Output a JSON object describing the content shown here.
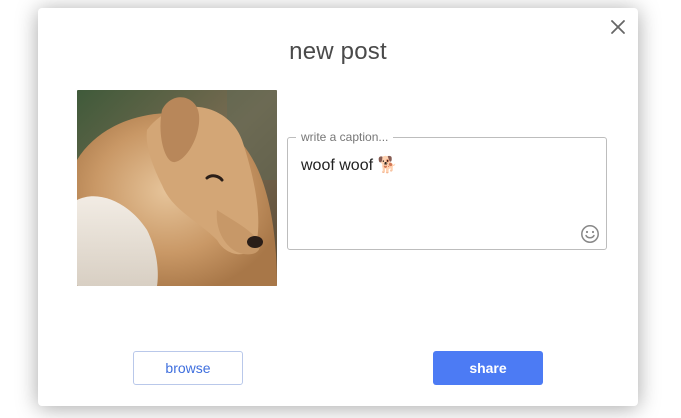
{
  "dialog": {
    "title": "new post",
    "close_icon": "close-icon"
  },
  "photo": {
    "subject": "dog-photo"
  },
  "caption": {
    "placeholder": "write a caption...",
    "value": "woof woof 🐕",
    "emoji_icon": "smiley-icon"
  },
  "actions": {
    "browse_label": "browse",
    "share_label": "share"
  },
  "colors": {
    "accent": "#4c7bf4",
    "link": "#3f6fde"
  }
}
